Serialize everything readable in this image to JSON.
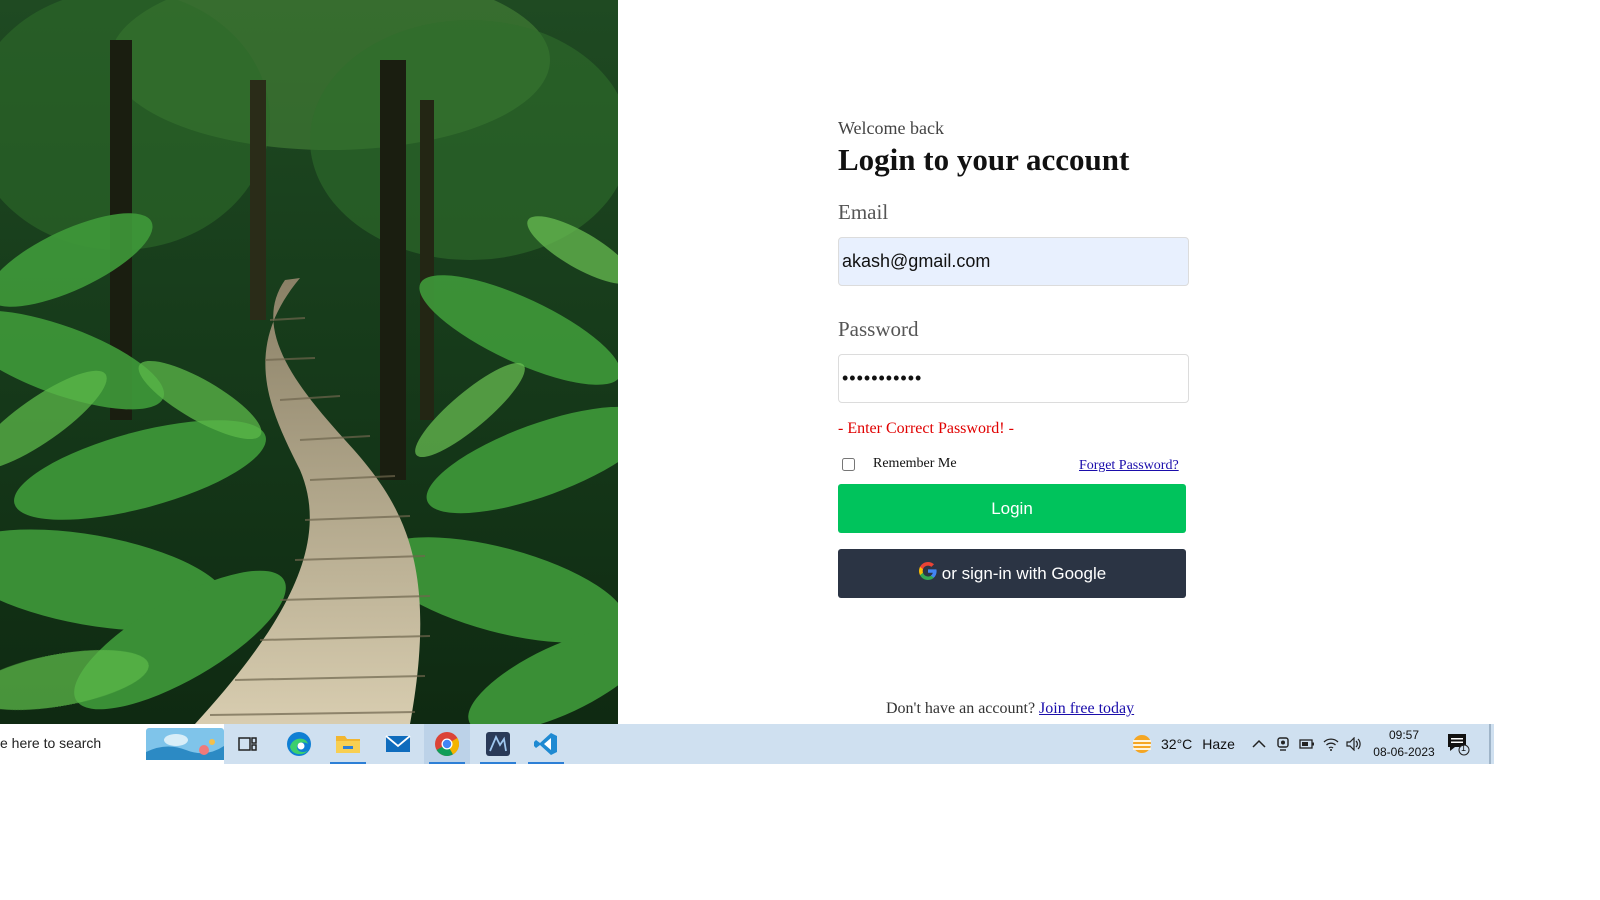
{
  "login": {
    "welcome": "Welcome back",
    "title": "Login to your account",
    "email_label": "Email",
    "email_value": "akash@gmail.com",
    "password_label": "Password",
    "password_value": "•••••••••••",
    "error": "- Enter Correct Password! -",
    "remember_label": "Remember Me",
    "forget_link": "Forget Password?",
    "login_button": "Login",
    "google_button": "or sign-in with Google",
    "signup_text": "Don't have an account?",
    "signup_link": "Join free today"
  },
  "taskbar": {
    "search_text": "e here to search",
    "weather_temp": "32°C",
    "weather_desc": "Haze",
    "time": "09:57",
    "date": "08-06-2023",
    "notification_count": "1",
    "apps": [
      "task-view-icon",
      "edge-icon",
      "file-explorer-icon",
      "mail-icon",
      "chrome-icon",
      "app-icon",
      "vscode-icon"
    ]
  },
  "colors": {
    "login_button": "#00c35c",
    "google_button": "#2b3444",
    "error": "#e00000",
    "email_bg": "#e8f0fe",
    "taskbar": "#cfe0f0"
  }
}
